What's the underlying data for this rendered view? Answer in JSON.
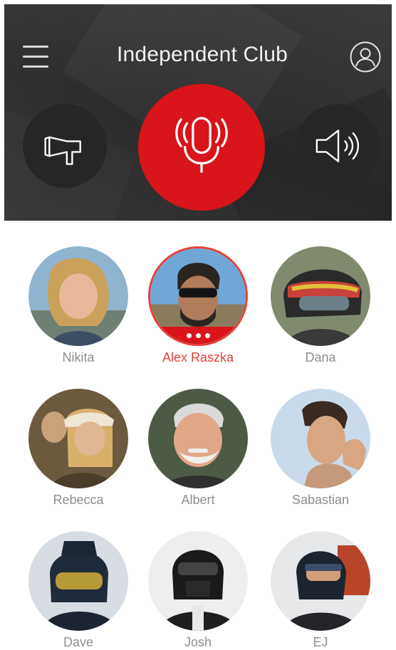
{
  "header": {
    "title": "Independent Club",
    "colors": {
      "background": "#333333",
      "accent": "#d9141b"
    }
  },
  "controls": {
    "menu_icon": "hamburger-menu-icon",
    "profile_icon": "user-profile-icon",
    "megaphone_icon": "megaphone-icon",
    "mic_icon": "microphone-broadcast-icon",
    "speaker_icon": "speaker-volume-icon"
  },
  "members": [
    {
      "name": "Nikita",
      "active": false
    },
    {
      "name": "Alex Raszka",
      "active": true
    },
    {
      "name": "Dana",
      "active": false
    },
    {
      "name": "Rebecca",
      "active": false
    },
    {
      "name": "Albert",
      "active": false
    },
    {
      "name": "Sabastian",
      "active": false
    },
    {
      "name": "Dave",
      "active": false
    },
    {
      "name": "Josh",
      "active": false
    },
    {
      "name": "EJ",
      "active": false
    }
  ]
}
